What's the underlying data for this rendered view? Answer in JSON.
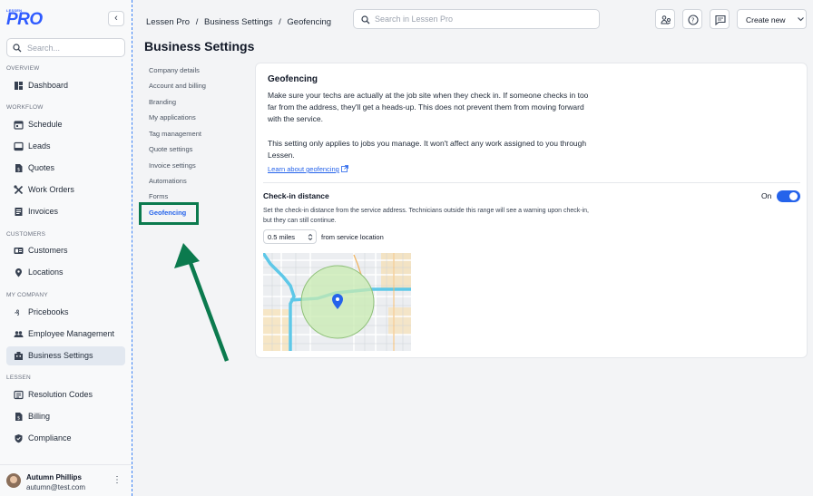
{
  "sidebar": {
    "logo_small": "LESSEN",
    "logo_main": "PRO",
    "collapse_icon": "chevron-left-icon",
    "search_placeholder": "Search...",
    "sections": [
      {
        "label": "OVERVIEW",
        "items": [
          {
            "label": "Dashboard",
            "icon": "dashboard-icon"
          }
        ]
      },
      {
        "label": "WORKFLOW",
        "items": [
          {
            "label": "Schedule",
            "icon": "calendar-icon"
          },
          {
            "label": "Leads",
            "icon": "inbox-icon"
          },
          {
            "label": "Quotes",
            "icon": "document-dollar-icon"
          },
          {
            "label": "Work Orders",
            "icon": "tools-icon"
          },
          {
            "label": "Invoices",
            "icon": "invoice-icon"
          }
        ]
      },
      {
        "label": "CUSTOMERS",
        "items": [
          {
            "label": "Customers",
            "icon": "id-card-icon"
          },
          {
            "label": "Locations",
            "icon": "map-pin-icon"
          }
        ]
      },
      {
        "label": "MY COMPANY",
        "items": [
          {
            "label": "Pricebooks",
            "icon": "price-tag-icon"
          },
          {
            "label": "Employee Management",
            "icon": "people-icon"
          },
          {
            "label": "Business Settings",
            "icon": "building-icon",
            "active": true
          }
        ]
      },
      {
        "label": "LESSEN",
        "items": [
          {
            "label": "Resolution Codes",
            "icon": "list-icon"
          },
          {
            "label": "Billing",
            "icon": "billing-icon"
          },
          {
            "label": "Compliance",
            "icon": "shield-icon"
          }
        ]
      }
    ],
    "user": {
      "name": "Autumn Phillips",
      "email": "autumn@test.com"
    }
  },
  "topbar": {
    "breadcrumb": [
      "Lessen Pro",
      "/",
      "Business Settings",
      "/",
      "Geofencing"
    ],
    "search_placeholder": "Search in Lessen Pro",
    "create_label": "Create new"
  },
  "page": {
    "title": "Business Settings"
  },
  "settings_nav": [
    {
      "label": "Company details"
    },
    {
      "label": "Account and billing"
    },
    {
      "label": "Branding"
    },
    {
      "label": "My applications"
    },
    {
      "label": "Tag management"
    },
    {
      "label": "Quote settings"
    },
    {
      "label": "Invoice settings"
    },
    {
      "label": "Automations"
    },
    {
      "label": "Forms"
    },
    {
      "label": "Geofencing",
      "active": true
    }
  ],
  "geofencing": {
    "title": "Geofencing",
    "description": "Make sure your techs are actually at the job site when they check in. If someone checks in too far from the address, they'll get a heads-up. This does not prevent them from moving forward with the service.",
    "note": "This setting only applies to jobs you manage. It won't affect any work assigned to you through Lessen.",
    "learn_link": "Learn about geofencing",
    "checkin_title": "Check-in distance",
    "toggle_label": "On",
    "toggle_on": true,
    "checkin_desc": "Set the check-in distance from the service address. Technicians outside this range will see a warning upon check-in, but they can still continue.",
    "distance_value": "0.5 miles",
    "distance_suffix": "from service location"
  },
  "colors": {
    "accent": "#2563eb",
    "annotation": "#0b7a4e",
    "brand": "#2f5bff"
  }
}
